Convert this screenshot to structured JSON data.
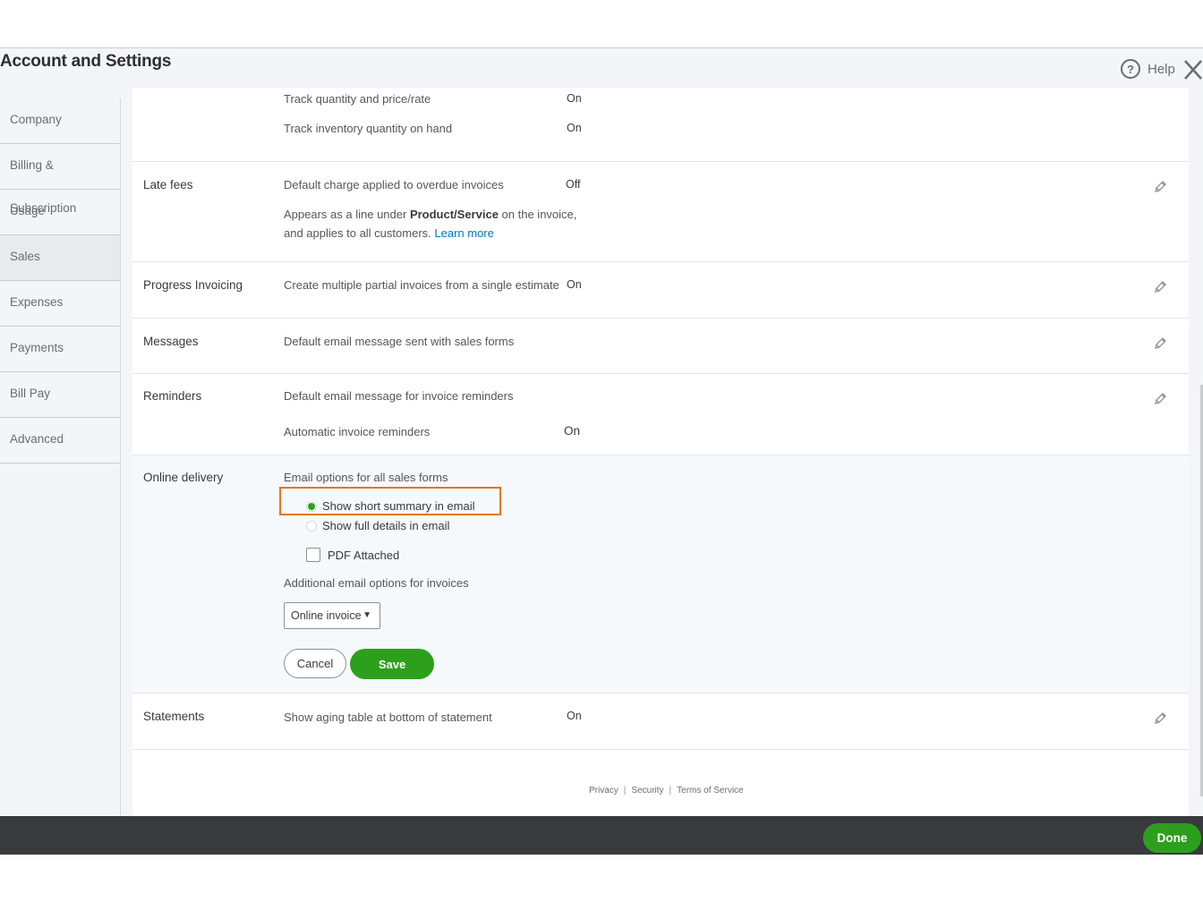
{
  "header": {
    "title": "Account and Settings",
    "help_label": "Help"
  },
  "sidebar": {
    "items": [
      {
        "label": "Company"
      },
      {
        "label": "Billing & Subscription"
      },
      {
        "label": "Usage"
      },
      {
        "label": "Sales"
      },
      {
        "label": "Expenses"
      },
      {
        "label": "Payments"
      },
      {
        "label": "Bill Pay"
      },
      {
        "label": "Advanced"
      }
    ],
    "active": "Sales"
  },
  "sections": {
    "top_partial": {
      "row1_text": "Track quantity and price/rate",
      "row1_value": "On",
      "row2_text": "Track inventory quantity on hand",
      "row2_value": "On"
    },
    "late_fees": {
      "label": "Late fees",
      "text": "Default charge applied to overdue invoices",
      "value": "Off",
      "desc_part1": "Appears as a line under ",
      "desc_bold": "Product/Service",
      "desc_part2": " on the invoice,",
      "desc_line2": "and applies to all customers.",
      "learn_more": "Learn more"
    },
    "progress_invoicing": {
      "label": "Progress Invoicing",
      "text": "Create multiple partial invoices from a single estimate",
      "value": "On"
    },
    "messages": {
      "label": "Messages",
      "text": "Default email message sent with sales forms"
    },
    "reminders": {
      "label": "Reminders",
      "text": "Default email message for invoice reminders",
      "auto_text": "Automatic invoice reminders",
      "auto_value": "On"
    },
    "online_delivery": {
      "label": "Online delivery",
      "email_options_label": "Email options for all sales forms",
      "radio_short": "Show short summary in email",
      "radio_full": "Show full details in email",
      "pdf_label": "PDF Attached",
      "additional_label": "Additional email options for invoices",
      "select_value": "Online invoice",
      "cancel_label": "Cancel",
      "save_label": "Save"
    },
    "statements": {
      "label": "Statements",
      "text": "Show aging table at bottom of statement",
      "value": "On"
    }
  },
  "footer": {
    "privacy": "Privacy",
    "security": "Security",
    "terms": "Terms of Service",
    "separator": "|"
  },
  "done_label": "Done",
  "colors": {
    "accent_green": "#2ca01c",
    "link_blue": "#0077c5",
    "highlight_orange": "#e2761d",
    "bottom_bar": "#393a3d"
  }
}
